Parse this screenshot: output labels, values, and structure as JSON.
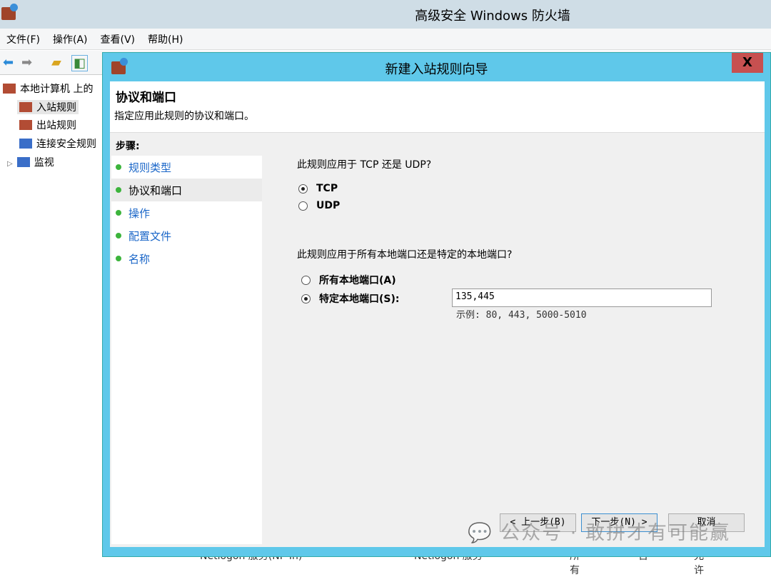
{
  "app": {
    "title": "高级安全 Windows 防火墙"
  },
  "menu": [
    "文件(F)",
    "操作(A)",
    "查看(V)",
    "帮助(H)"
  ],
  "tree": {
    "root": "本地计算机 上的",
    "items": [
      "入站规则",
      "出站规则",
      "连接安全规则",
      "监视"
    ]
  },
  "background_row": {
    "name": "Netlogon 服务(NP-In)",
    "group": "Netlogon 服务",
    "profile": "所有",
    "enabled": "否",
    "action": "允许"
  },
  "dialog": {
    "title": "新建入站规则向导",
    "close": "X",
    "heading": "协议和端口",
    "subheading": "指定应用此规则的协议和端口。",
    "steps_label": "步骤:",
    "steps": [
      "规则类型",
      "协议和端口",
      "操作",
      "配置文件",
      "名称"
    ],
    "current_step": 1,
    "q1": "此规则应用于 TCP 还是 UDP?",
    "protocol_options": [
      "TCP",
      "UDP"
    ],
    "protocol_selected": "TCP",
    "q2": "此规则应用于所有本地端口还是特定的本地端口?",
    "port_options": [
      "所有本地端口(A)",
      "特定本地端口(S):"
    ],
    "port_selected": "特定本地端口(S):",
    "port_value": "135,445",
    "port_example": "示例: 80, 443, 5000-5010",
    "buttons": {
      "back": "< 上一步(B)",
      "next": "下一步(N) >",
      "cancel": "取消"
    }
  },
  "watermark": "公众号 · 敢拼才有可能赢"
}
